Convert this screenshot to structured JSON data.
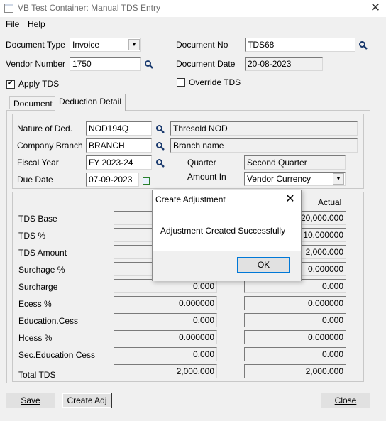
{
  "window": {
    "title": "VB Test Container: Manual TDS Entry",
    "close_glyph": "✕"
  },
  "menu": {
    "file": "File",
    "help": "Help"
  },
  "header": {
    "document_type_label": "Document Type",
    "document_type_value": "Invoice",
    "vendor_number_label": "Vendor Number",
    "vendor_number_value": "1750",
    "document_no_label": "Document No",
    "document_no_value": "TDS68",
    "document_date_label": "Document Date",
    "document_date_value": "20-08-2023",
    "apply_tds_label": "Apply TDS",
    "apply_tds_checked": true,
    "override_tds_label": "Override TDS",
    "override_tds_checked": false
  },
  "tabs": [
    {
      "label": "Document",
      "active": false
    },
    {
      "label": "Deduction Detail",
      "active": true
    }
  ],
  "deduction": {
    "nature_label": "Nature of Ded.",
    "nature_value": "NOD194Q",
    "nature_desc": "Thresold NOD",
    "branch_label": "Company Branch",
    "branch_value": "BRANCH",
    "branch_desc": "Branch name",
    "fiscal_label": "Fiscal Year",
    "fiscal_value": "FY 2023-24",
    "quarter_label": "Quarter",
    "quarter_value": "Second Quarter",
    "due_label": "Due Date",
    "due_value": "07-09-2023",
    "amount_in_label": "Amount In",
    "amount_in_value": "Vendor Currency"
  },
  "amounts": {
    "actual_header": "Actual",
    "rows": [
      {
        "label": "TDS Base",
        "left": "",
        "actual": "20,000.000"
      },
      {
        "label": "TDS %",
        "left": "",
        "actual": "10.000000"
      },
      {
        "label": "TDS Amount",
        "left": "",
        "actual": "2,000.000"
      },
      {
        "label": "Surchage %",
        "left": "",
        "actual": "0.000000"
      },
      {
        "label": "Surcharge",
        "left": "0.000",
        "actual": "0.000"
      },
      {
        "label": "Ecess %",
        "left": "0.000000",
        "actual": "0.000000"
      },
      {
        "label": "Education.Cess",
        "left": "0.000",
        "actual": "0.000"
      },
      {
        "label": "Hcess %",
        "left": "0.000000",
        "actual": "0.000000"
      },
      {
        "label": "Sec.Education Cess",
        "left": "0.000",
        "actual": "0.000"
      },
      {
        "label": "Total TDS",
        "left": "2,000.000",
        "actual": "2,000.000"
      }
    ]
  },
  "buttons": {
    "save": "Save",
    "create_adj": "Create Adj",
    "close": "Close"
  },
  "dialog": {
    "title": "Create Adjustment",
    "message": "Adjustment Created Successfully",
    "ok": "OK",
    "close_glyph": "✕"
  }
}
